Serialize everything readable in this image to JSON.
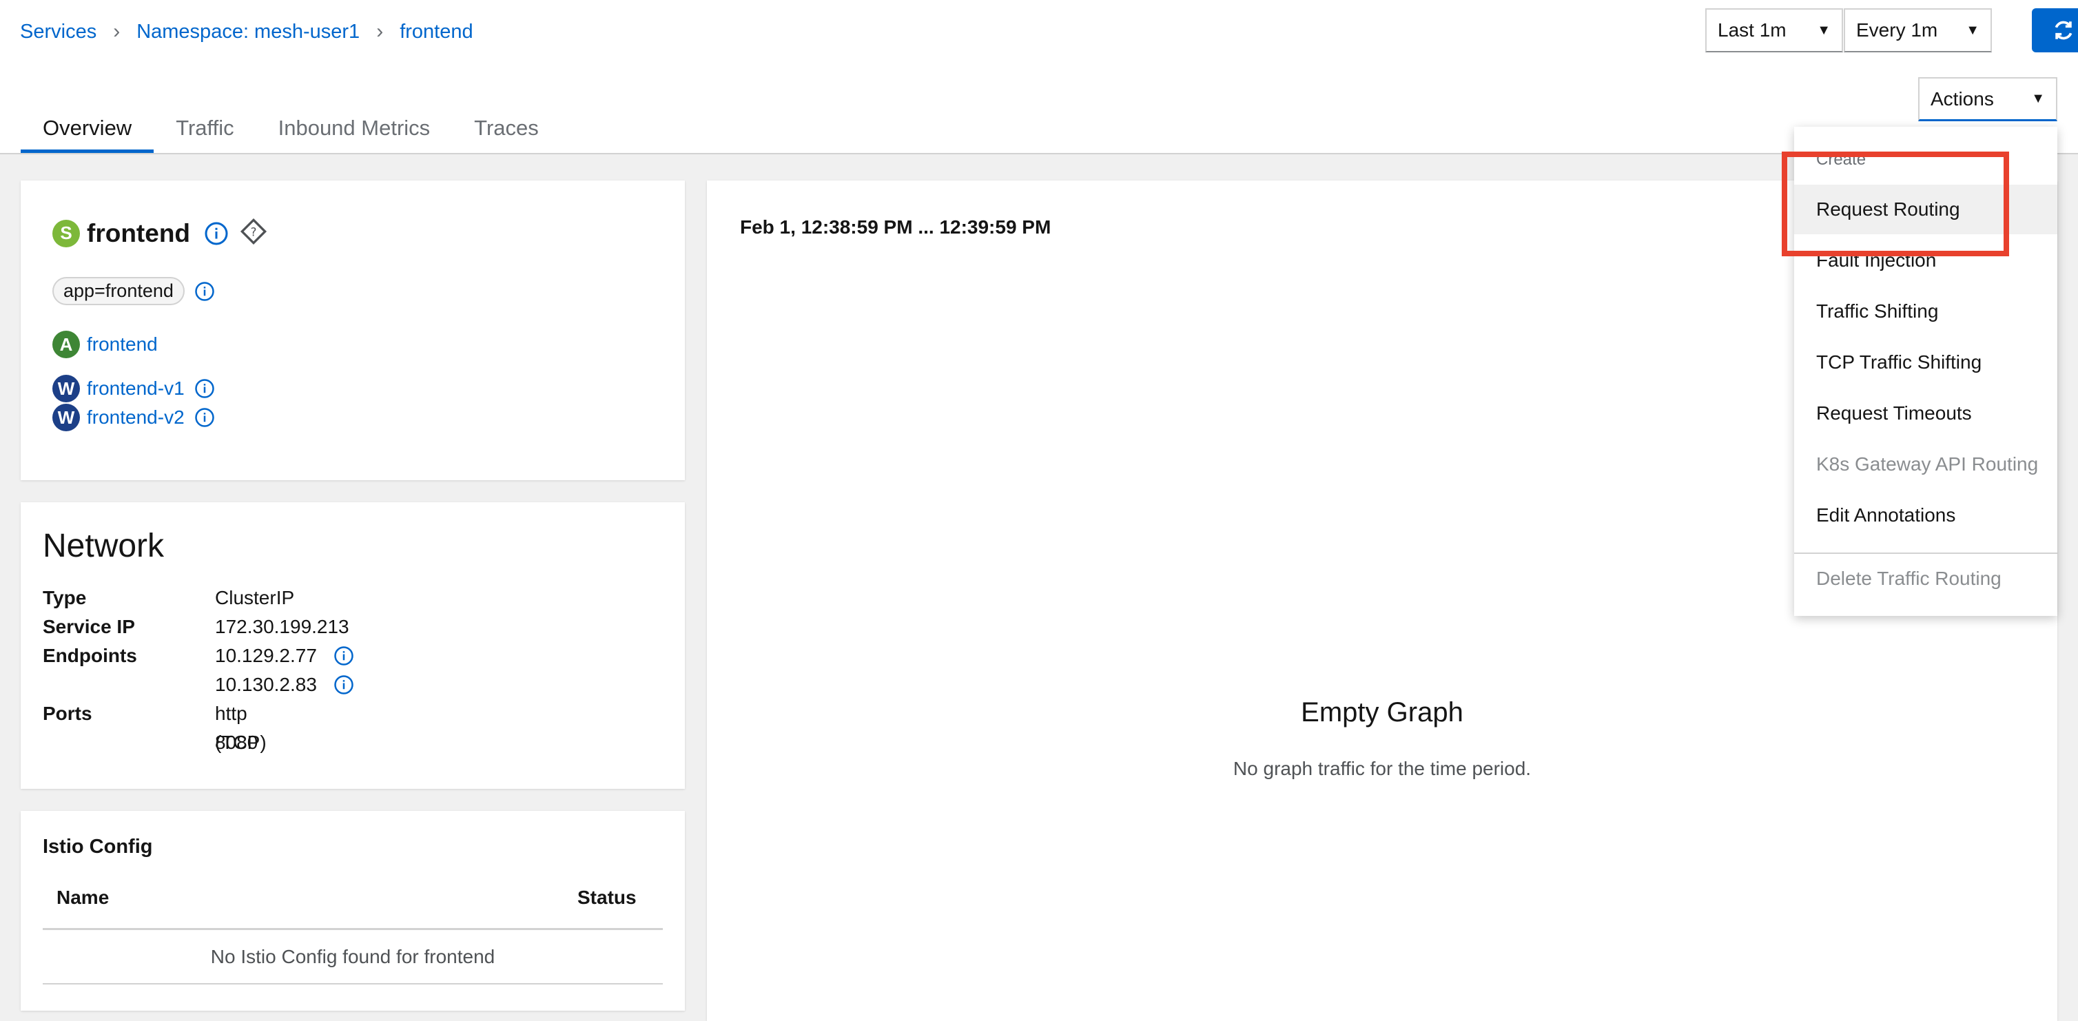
{
  "breadcrumb": [
    "Services",
    "Namespace: mesh-user1",
    "frontend"
  ],
  "duration_select": "Last 1m",
  "refresh_select": "Every 1m",
  "actions_label": "Actions",
  "tabs": [
    "Overview",
    "Traffic",
    "Inbound Metrics",
    "Traces"
  ],
  "service": {
    "badge": "S",
    "name": "frontend",
    "label": "app=frontend",
    "app": {
      "badge": "A",
      "name": "frontend"
    },
    "workloads": [
      {
        "badge": "W",
        "name": "frontend-v1"
      },
      {
        "badge": "W",
        "name": "frontend-v2"
      }
    ]
  },
  "network": {
    "title": "Network",
    "type_key": "Type",
    "type_val": "ClusterIP",
    "ip_key": "Service IP",
    "ip_val": "172.30.199.213",
    "endpoints_key": "Endpoints",
    "endpoints": [
      "10.129.2.77",
      "10.130.2.83"
    ],
    "ports_key": "Ports",
    "ports_val1": "http 8080",
    "ports_val2": "(TCP)"
  },
  "istio": {
    "title": "Istio Config",
    "col_name": "Name",
    "col_status": "Status",
    "empty": "No Istio Config found for frontend"
  },
  "graph": {
    "timerange": "Feb 1, 12:38:59 PM ... 12:39:59 PM",
    "empty_title": "Empty Graph",
    "empty_sub": "No graph traffic for the time period."
  },
  "menu": {
    "group": "Create",
    "items": [
      "Request Routing",
      "Fault Injection",
      "Traffic Shifting",
      "TCP Traffic Shifting",
      "Request Timeouts",
      "K8s Gateway API Routing",
      "Edit Annotations"
    ],
    "delete": "Delete Traffic Routing"
  },
  "colors": {
    "link": "#0066cc",
    "service_badge": "#7db83a",
    "app_badge": "#3e8635",
    "workload_badge": "#1c3f87",
    "highlight": "#e8412d"
  }
}
